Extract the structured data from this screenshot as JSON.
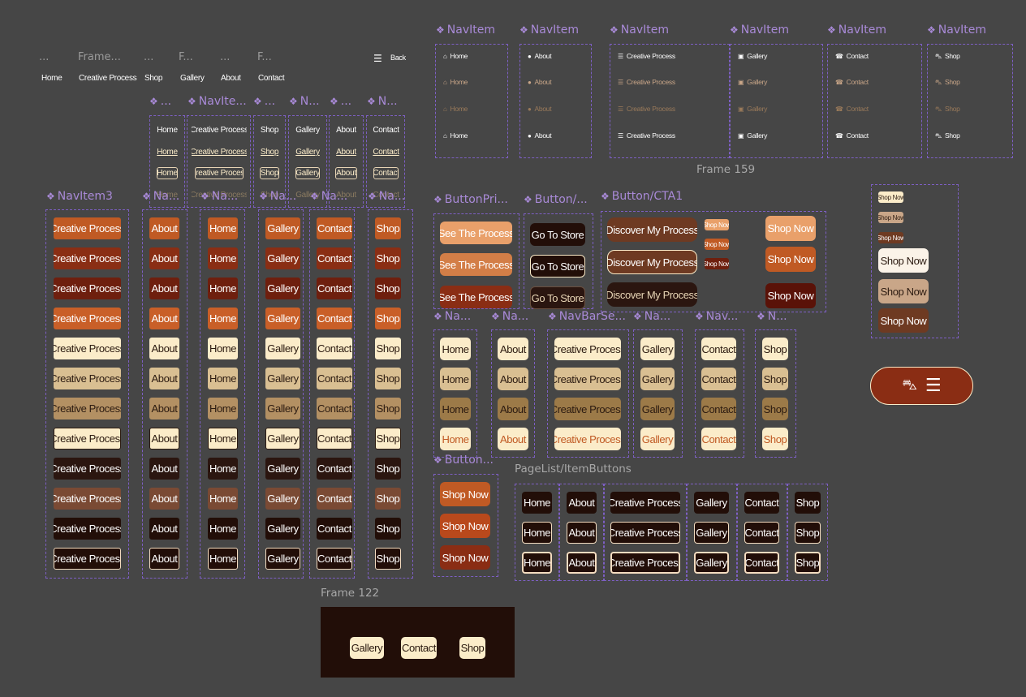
{
  "colors": {
    "canvas": "#464646",
    "component_label": "#a98ad8",
    "frame_border": "#7d5fc3",
    "orange": "#c05a24",
    "rust": "#8a2e14",
    "dark_red": "#6e1f0e",
    "cream": "#fbecc9",
    "tan": "#d9bf92",
    "brown": "#b39063",
    "dark_brown": "#2b1610",
    "mocha": "#7a4a34",
    "espresso": "#220e08"
  },
  "top_nav": {
    "ellipsis": "...",
    "frame_label_1": "Frame...",
    "frame_label_2": "F...",
    "frame_label_3": "F...",
    "items": [
      "Home",
      "Creative Process",
      "Shop",
      "Gallery",
      "About",
      "Contact"
    ],
    "back_label": "Back",
    "menu_icon": "hamburger-icon"
  },
  "navite_labels": [
    "...",
    "NavIte...",
    "...",
    "N...",
    "...",
    "N..."
  ],
  "navite_cols": [
    [
      "Home",
      "Home",
      "Home",
      "Home"
    ],
    [
      "Creative Process",
      "Creative Process",
      "Creative Process",
      "Creative Process"
    ],
    [
      "Shop",
      "Shop",
      "Shop",
      "Shop"
    ],
    [
      "Gallery",
      "Gallery",
      "Gallery",
      "Gallery"
    ],
    [
      "About",
      "About",
      "About",
      "About"
    ],
    [
      "Contact",
      "Contact",
      "Contact",
      "Contact"
    ]
  ],
  "navitem3": {
    "labels": [
      "NavItem3",
      "Na...",
      "Na...",
      "Na...",
      "Na...",
      "Na..."
    ],
    "columns": [
      "Creative Process",
      "About",
      "Home",
      "Gallery",
      "Contact",
      "Shop"
    ]
  },
  "navitem_top": {
    "labels": [
      "NavItem",
      "NavItem",
      "NavItem",
      "NavItem",
      "NavItem",
      "NavItem"
    ],
    "columns": [
      {
        "text": "Home",
        "icon": "home-icon"
      },
      {
        "text": "About",
        "icon": "info-icon"
      },
      {
        "text": "Creative Process",
        "icon": "list-icon"
      },
      {
        "text": "Gallery",
        "icon": "image-icon"
      },
      {
        "text": "Contact",
        "icon": "phone-icon"
      },
      {
        "text": "Shop",
        "icon": "bag-icon"
      }
    ]
  },
  "frame159": "Frame 159",
  "buttons": {
    "primary_label": "ButtonPri...",
    "primary_text": "See The Process",
    "secondary_label": "Button/...",
    "secondary_text": "Go To Store",
    "cta_label": "Button/CTA1",
    "cta_text": "Discover My Process",
    "shop_text": "Shop Now",
    "button_label": "Button..."
  },
  "navbar_labels": [
    "Na...",
    "Na...",
    "NavBarSe...",
    "Na...",
    "Nav...",
    "N..."
  ],
  "navbar_cols": [
    "Home",
    "About",
    "Creative Process",
    "Gallery",
    "Contact",
    "Shop"
  ],
  "pagelist": {
    "label": "PageList/ItemButtons",
    "cols": [
      "Home",
      "About",
      "Creative Process",
      "Gallery",
      "Contact",
      "Shop"
    ]
  },
  "frame122": {
    "label": "Frame 122",
    "items": [
      "Gallery",
      "Contact",
      "Shop"
    ]
  },
  "mobile_bar": {
    "icons": [
      "shop-bag-icon",
      "hamburger-icon"
    ]
  }
}
